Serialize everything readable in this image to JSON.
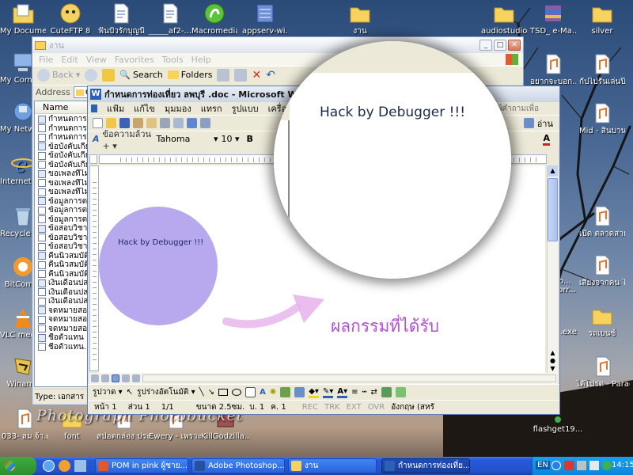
{
  "desktop": {
    "icons_left": [
      {
        "label": "My Documents",
        "icon": "my-documents-icon",
        "color": "#f4d45a"
      },
      {
        "label": "My Computer",
        "icon": "my-computer-icon",
        "color": "#8fb5e8"
      },
      {
        "label": "My Network Places",
        "icon": "network-places-icon",
        "color": "#6da0dc"
      },
      {
        "label": "Internet Explorer",
        "icon": "internet-explorer-icon",
        "color": "#3b83e0"
      },
      {
        "label": "Recycle Bin",
        "icon": "recycle-bin-icon",
        "color": "#bcd4ea"
      },
      {
        "label": "BitComet",
        "icon": "bitcomet-icon",
        "color": "#f29a2e"
      },
      {
        "label": "VLC media player",
        "icon": "vlc-icon",
        "color": "#f08a1c"
      },
      {
        "label": "Winamp",
        "icon": "winamp-icon",
        "color": "#e6c24a"
      }
    ],
    "icons_top": [
      {
        "label": "CuteFTP 8",
        "icon": "cuteftp-icon",
        "color": "#f2d260"
      },
      {
        "label": "ฟันปั๋วรักบุญนี่",
        "icon": "text-file-icon",
        "color": "#ffffff"
      },
      {
        "label": "_____af2-...",
        "icon": "text-file-icon",
        "color": "#ffffff"
      },
      {
        "label": "Macromedia",
        "icon": "macromedia-icon",
        "color": "#5bc23c"
      },
      {
        "label": "appserv-wi...",
        "icon": "appserv-icon",
        "color": "#6c8fd8"
      }
    ],
    "icons_right": [
      {
        "label": "งาน",
        "icon": "folder-icon",
        "color": "#f7d35e"
      },
      {
        "label": "audiostudio9",
        "icon": "folder-icon",
        "color": "#f7d35e"
      },
      {
        "label": "TSD_ e-Ma...",
        "icon": "winrar-icon",
        "color": "#8e5aa8"
      },
      {
        "label": "silver",
        "icon": "folder-icon",
        "color": "#f7d35e"
      },
      {
        "label": "อยากจะบอก...",
        "icon": "mp3-file-icon",
        "color": "#ffffff"
      },
      {
        "label": "กัปไปรันเล่นปิด มีมาน - ธรร...",
        "icon": "mp3-file-icon",
        "color": "#ffffff"
      },
      {
        "label": "Mid - สินบาน ใหม่.mp3",
        "icon": "mp3-file-icon",
        "color": "#ffffff"
      },
      {
        "label": "เปิด ตลาดสายพา...",
        "icon": "mp3-file-icon",
        "color": "#ffffff"
      },
      {
        "label": "เสียงจากคน ไกลตัว Z...",
        "icon": "mp3-file-icon",
        "color": "#ffffff"
      },
      {
        "label": "รถเบนซ์",
        "icon": "folder-icon",
        "color": "#f7d35e"
      },
      {
        "label": "ได้โปรด - Paradox.mp3",
        "icon": "mp3-file-icon",
        "color": "#ffffff"
      }
    ],
    "icons_bottom": [
      {
        "label": "033- ลม จ้า.mp3",
        "icon": "mp3-file-icon",
        "color": "#ffffff"
      },
      {
        "label": "font",
        "icon": "folder-icon",
        "color": "#f7d35e"
      },
      {
        "label": "สปอตกล่อง ประหยัดน้ำมั...",
        "icon": "mp3-file-icon",
        "color": "#ffffff"
      },
      {
        "label": "Ewery - เพราะ เธอหรือเปล่...",
        "icon": "mp3-file-icon",
        "color": "#ffffff"
      },
      {
        "label": "KillGodzilla...",
        "icon": "exe-icon",
        "color": "#a05050"
      }
    ],
    "partial_labels": {
      "rio": "io.mp3",
      "dozorr": "oo...\nzorr...",
      "exe": ".exe",
      "flashget": "flashget19..."
    },
    "watermark": "Photograph Photobucket"
  },
  "explorer": {
    "title": "งาน",
    "menu": [
      "File",
      "Edit",
      "View",
      "Favorites",
      "Tools",
      "Help"
    ],
    "back": "Back",
    "search": "Search",
    "folders": "Folders",
    "address_label": "Address",
    "address_value": "C:",
    "column_name": "Name",
    "files": [
      "กำหนดการทร",
      "กำหนดการทร",
      "กำหนดการทร",
      "ข้อบังคับเกี่ย",
      "ข้อบังคับเกี่ย",
      "ข้อบังคับเกี่ย",
      "ขอเพลงที่ไม่",
      "ขอเพลงที่ไม่",
      "ขอเพลงที่ไม่",
      "ข้อมูลการตล",
      "ข้อมูลการตล",
      "ข้อมูลการตล",
      "ข้อสอบวิชาไ",
      "ข้อสอบวิชาไ",
      "ข้อสอบวิชาไ",
      "คืนนิวสมบัติ",
      "คืนนิวสมบัติ",
      "คืนนิวสมบัติ",
      "เงินเดือนปส",
      "เงินเดือนปส.",
      "เงินเดือนปส.",
      "จดหมายสอา",
      "จดหมายสอา",
      "จดหมายสอา",
      "ชื่อตัวแทน .",
      "ชื่อตัวแทน."
    ],
    "status": "Type: เอกสาร M"
  },
  "word": {
    "title": "กำหนดการท่องเที่ยว ลพบุรี .doc - Microsoft Word",
    "menu": [
      "แฟ้ม",
      "แก้ไข",
      "มุมมอง",
      "แทรก",
      "รูปแบบ",
      "เครื่องมือ",
      "ตา"
    ],
    "style_name": "ข้อความล้วน +",
    "font_name": "Tahoma",
    "font_size": "10",
    "bold": "B",
    "read": "อ่าน",
    "question_text": "พิมพ์คำถามเพื่อ",
    "draw_label": "รูปวาด",
    "autoshapes_label": "รูปร่างอัตโนมัติ",
    "status": {
      "page": "หน้า 1",
      "section": "ส่วน 1",
      "pages": "1/1",
      "at": "ขนาด 2.5ซม.",
      "ln": "บ. 1",
      "col": "ค. 1",
      "rec": "REC",
      "trk": "TRK",
      "ext": "EXT",
      "ovr": "OVR",
      "lang": "อังกฤษ (สหรั"
    }
  },
  "doc": {
    "circle_text": "Hack by Debugger !!!",
    "circle_color": "#b8a9ee"
  },
  "lens": {
    "text": "Hack by Debugger !!!"
  },
  "annotation": {
    "text": "ผลกรรมที่ได้รับ",
    "color": "#b24ed8"
  },
  "taskbar": {
    "start": "start",
    "items": [
      {
        "label": "POM in pink ผู้ชาย...",
        "color": "#e4572e"
      },
      {
        "label": "Adobe Photoshop...",
        "color": "#2a4f9c"
      },
      {
        "label": "งาน",
        "color": "#f7d35e"
      },
      {
        "label": "กำหนดการท่องเที่ย...",
        "color": "#2b5fb8"
      }
    ],
    "lang": "EN",
    "clock": "14:15"
  }
}
